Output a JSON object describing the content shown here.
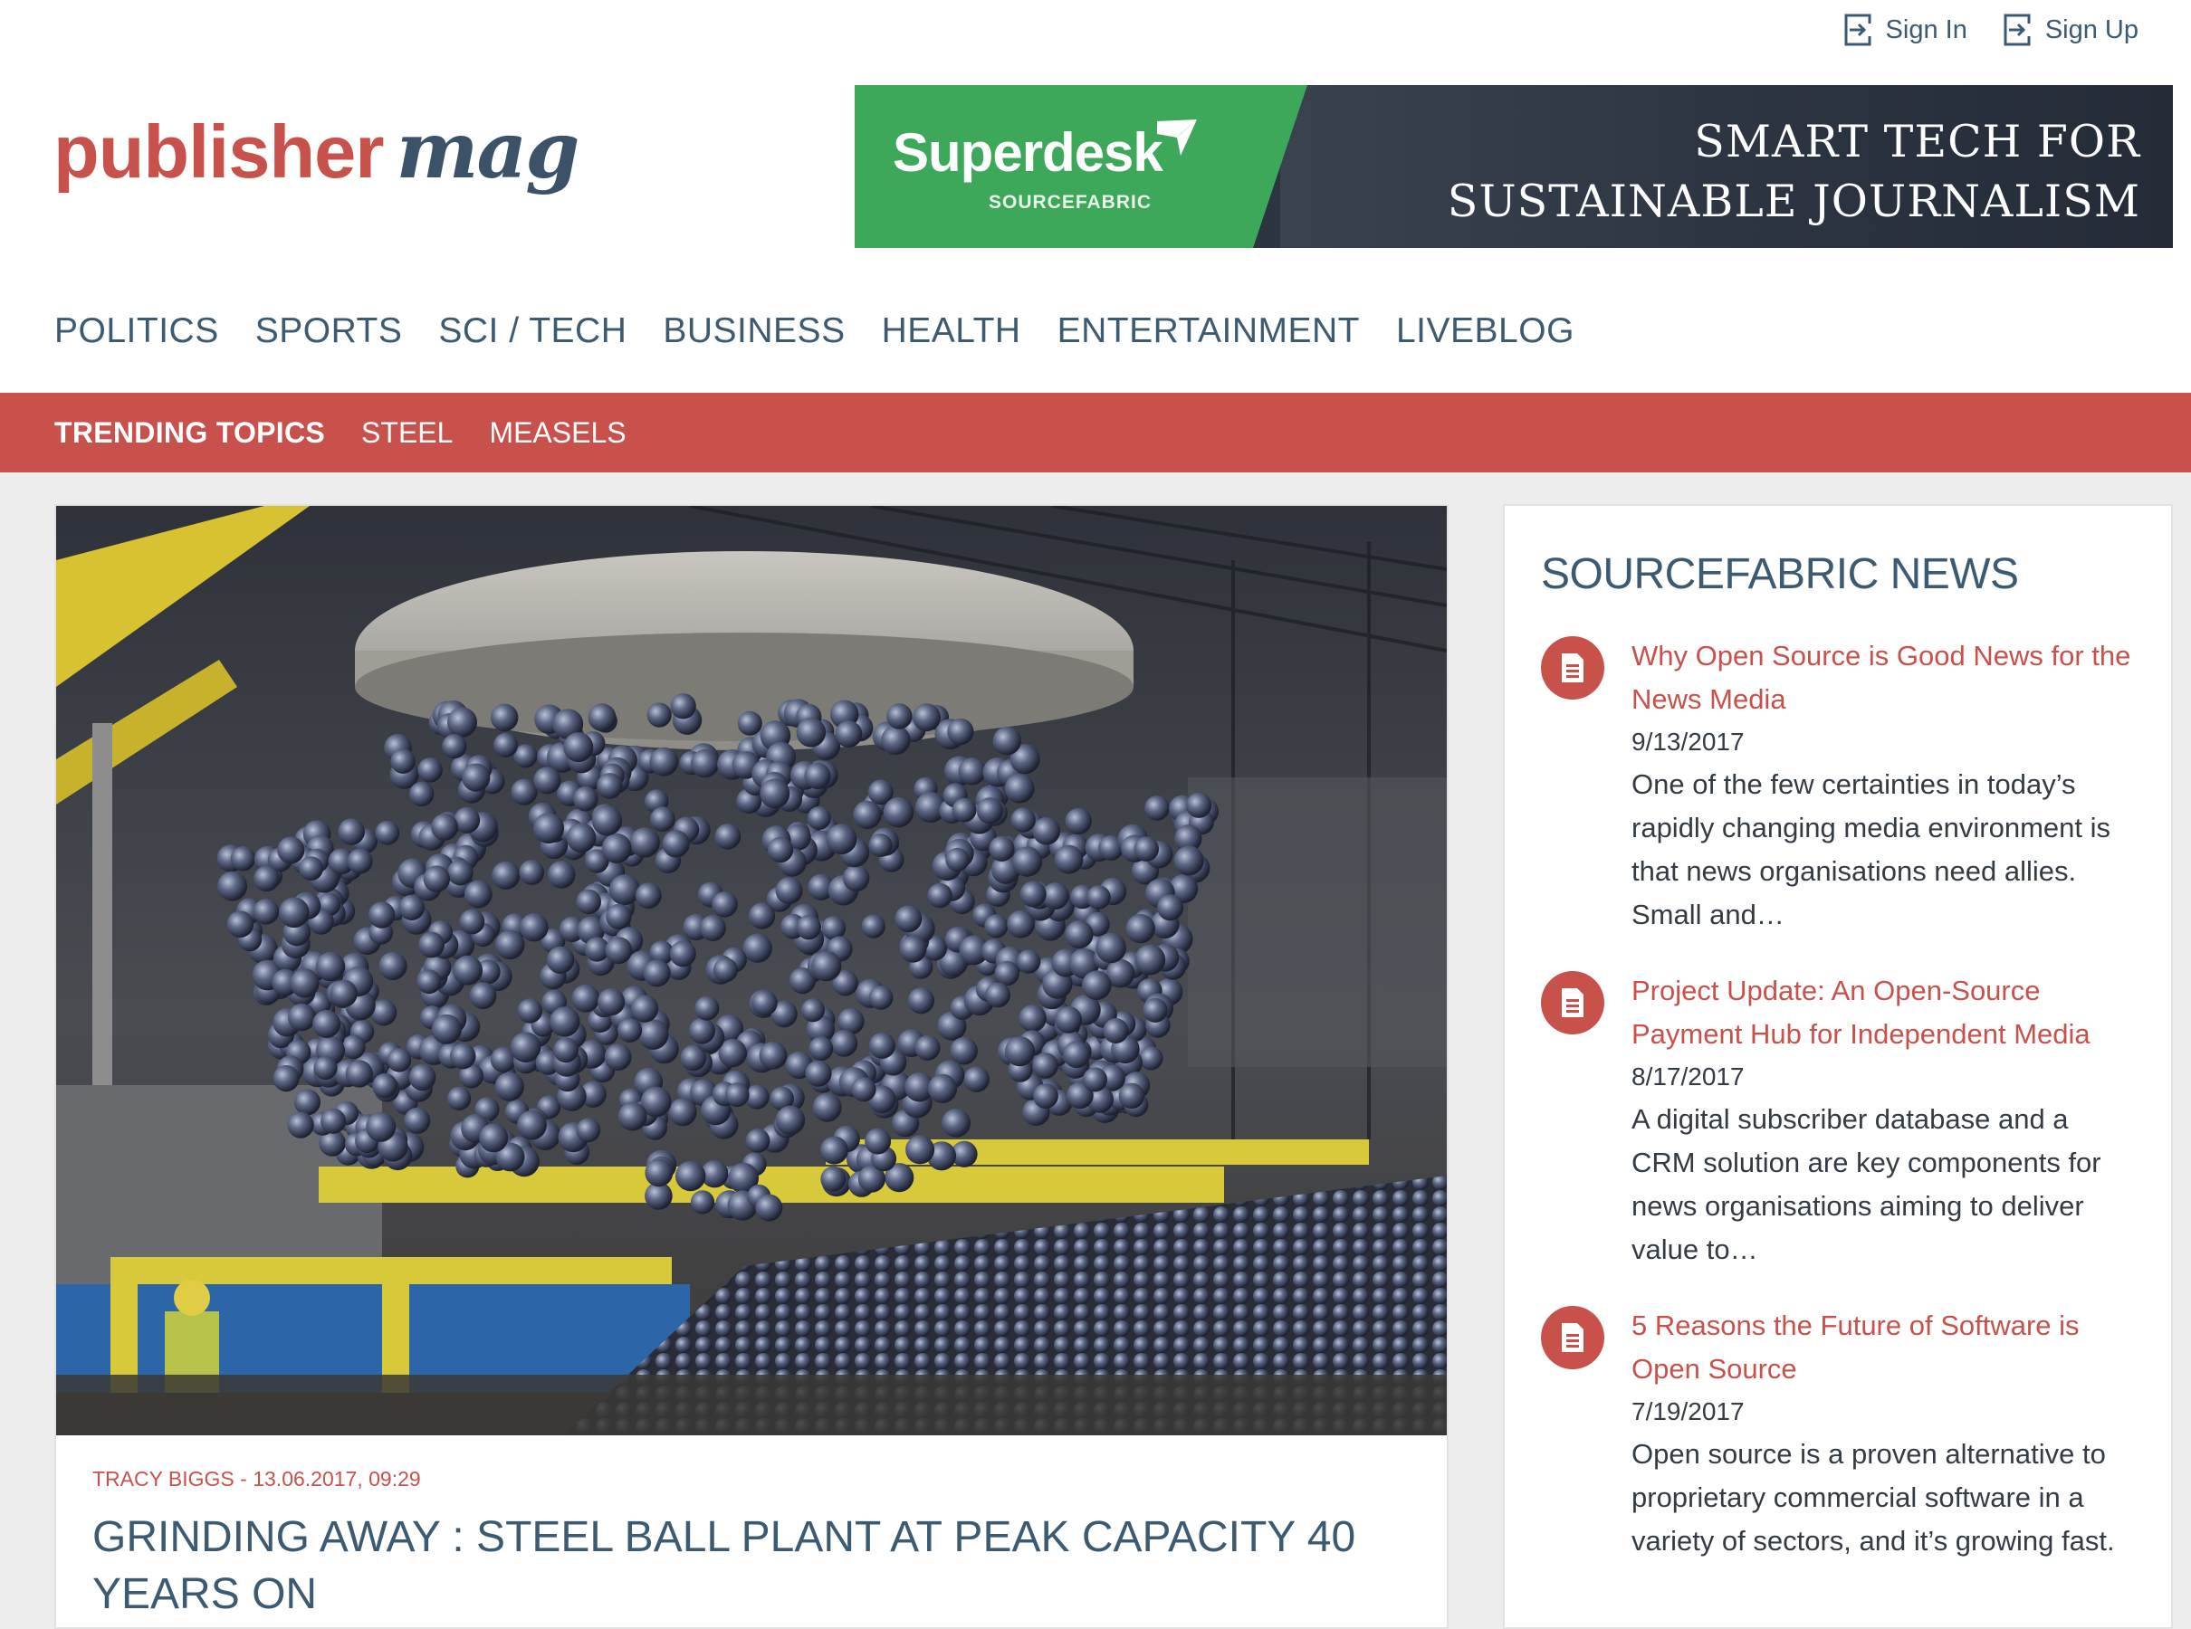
{
  "header": {
    "sign_in": "Sign In",
    "sign_up": "Sign Up",
    "logo_primary": "publisher",
    "logo_secondary": "mag"
  },
  "banner": {
    "brand": "Superdesk",
    "brand_sub": "SOURCEFABRIC",
    "tagline_1": "SMART TECH FOR",
    "tagline_2": "SUSTAINABLE JOURNALISM"
  },
  "nav": {
    "items": [
      "POLITICS",
      "SPORTS",
      "SCI / TECH",
      "BUSINESS",
      "HEALTH",
      "ENTERTAINMENT",
      "LIVEBLOG"
    ]
  },
  "trending": {
    "title": "TRENDING TOPICS",
    "items": [
      "STEEL",
      "MEASELS"
    ]
  },
  "article": {
    "byline": "TRACY BIGGS - 13.06.2017, 09:29",
    "headline": "GRINDING AWAY : STEEL BALL PLANT AT PEAK CAPACITY 40 YEARS ON"
  },
  "sidebar": {
    "title": "SOURCEFABRIC NEWS",
    "items": [
      {
        "title": "Why Open Source is Good News for the News Media",
        "date": "9/13/2017",
        "summary": "One of the few certainties in today’s rapidly changing media environment is that news organisations need allies. Small and…"
      },
      {
        "title": "Project Update: An Open-Source Payment Hub for Independent Media",
        "date": "8/17/2017",
        "summary": "A digital subscriber database and a CRM solution are key components for news organisations aiming to deliver value to…"
      },
      {
        "title": "5 Reasons the Future of Software is Open Source",
        "date": "7/19/2017",
        "summary": "Open source is a proven alternative to proprietary commercial software in a variety of sectors, and it’s growing fast."
      }
    ]
  },
  "colors": {
    "accent": "#c9514c",
    "nav_text": "#3d5a73",
    "banner_green": "#3ea85a",
    "banner_dark": "#2c3442"
  },
  "icons": {
    "sign_in": "sign-in-icon",
    "sign_up": "sign-up-icon",
    "news_item": "document-icon"
  }
}
